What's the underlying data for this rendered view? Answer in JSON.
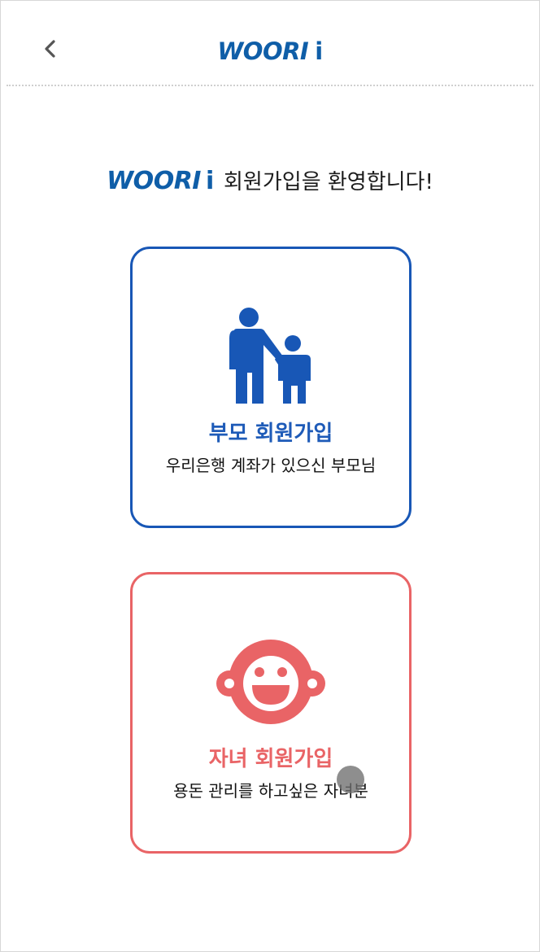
{
  "header": {
    "logo_text": "WOORI",
    "logo_suffix": "i",
    "back_icon": "chevron-left-icon"
  },
  "welcome": {
    "brand": "WOORI",
    "brand_suffix": "i",
    "message": "회원가입을 환영합니다!"
  },
  "cards": {
    "parent": {
      "title": "부모 회원가입",
      "description": "우리은행 계좌가 있으신 부모님",
      "icon": "parent-child-icon",
      "color": "#1857b6"
    },
    "child": {
      "title": "자녀 회원가입",
      "description": "용돈 관리를 하고싶은 자녀분",
      "icon": "baby-face-icon",
      "color": "#e96466"
    }
  },
  "colors": {
    "brand_blue": "#0f5ea8",
    "accent_red": "#e96466"
  }
}
